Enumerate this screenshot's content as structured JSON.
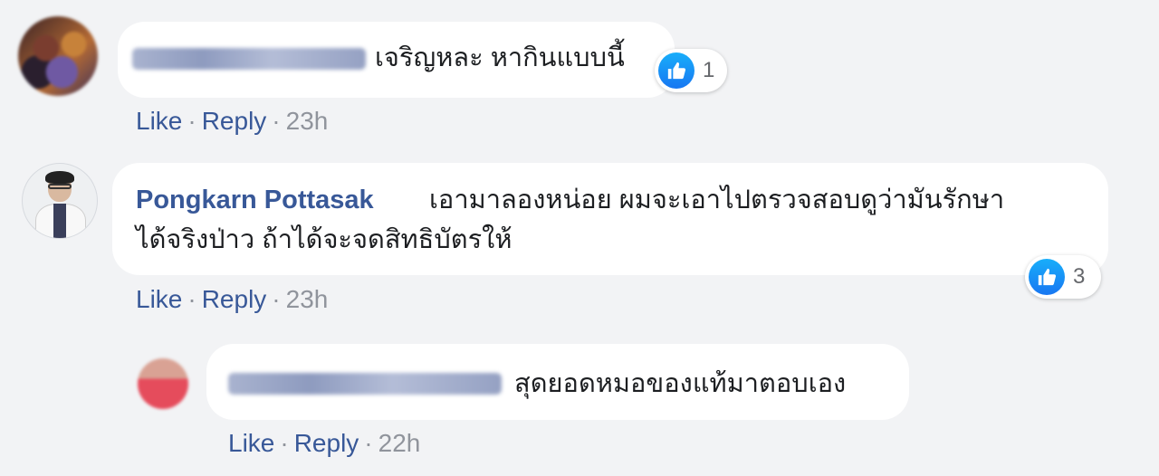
{
  "comments": [
    {
      "author": "",
      "text": "เจริญหละ หากินแบบนี้",
      "reaction_count": "1",
      "like_label": "Like",
      "reply_label": "Reply",
      "time": "23h",
      "separator": "·"
    },
    {
      "author": "Pongkarn Pottasak",
      "text_line1": "เอามาลองหน่อย ผมจะเอาไปตรวจสอบดูว่ามันรักษา",
      "text_line2": "ได้จริงป่าว ถ้าได้จะจดสิทธิบัตรให้",
      "reaction_count": "3",
      "like_label": "Like",
      "reply_label": "Reply",
      "time": "23h",
      "separator": "·"
    },
    {
      "author": "",
      "text": "สุดยอดหมอของแท้มาตอบเอง",
      "like_label": "Like",
      "reply_label": "Reply",
      "time": "22h",
      "separator": "·"
    }
  ],
  "colors": {
    "background": "#f2f3f5",
    "bubble": "#ffffff",
    "name_link": "#385898",
    "meta_gray": "#90949c",
    "like_blue": "#1877f2"
  },
  "icons": [
    "like-thumb-icon"
  ]
}
